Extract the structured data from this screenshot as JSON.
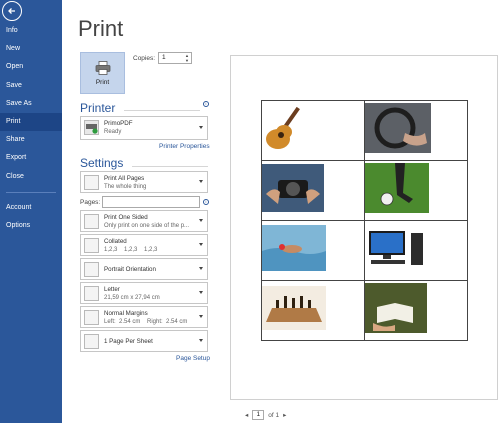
{
  "nav": {
    "items": [
      "Info",
      "New",
      "Open",
      "Save",
      "Save As",
      "Print",
      "Share",
      "Export",
      "Close"
    ],
    "bottom_items": [
      "Account",
      "Options"
    ],
    "active": "Print"
  },
  "title": "Print",
  "print_button": "Print",
  "copies": {
    "label": "Copies:",
    "value": "1"
  },
  "printer": {
    "heading": "Printer",
    "name": "PrimoPDF",
    "status": "Ready",
    "properties_link": "Printer Properties"
  },
  "settings": {
    "heading": "Settings",
    "print_what": {
      "title": "Print All Pages",
      "sub": "The whole thing"
    },
    "pages_label": "Pages:",
    "sides": {
      "title": "Print One Sided",
      "sub": "Only print on one side of the p..."
    },
    "collate": {
      "title": "Collated",
      "sub": "1,2,3    1,2,3    1,2,3"
    },
    "orientation": {
      "title": "Portrait Orientation"
    },
    "paper": {
      "title": "Letter",
      "sub": "21,59 cm x 27,94 cm"
    },
    "margins": {
      "title": "Normal Margins",
      "sub": "Left:  2.54 cm    Right:  2.54 cm"
    },
    "per_sheet": {
      "title": "1 Page Per Sheet"
    },
    "page_setup_link": "Page Setup"
  },
  "pager": {
    "current": "1",
    "of_label": "of 1"
  },
  "colors": {
    "sidebar": "#2b579a",
    "active": "#1d4586",
    "accent": "#2b579a"
  }
}
